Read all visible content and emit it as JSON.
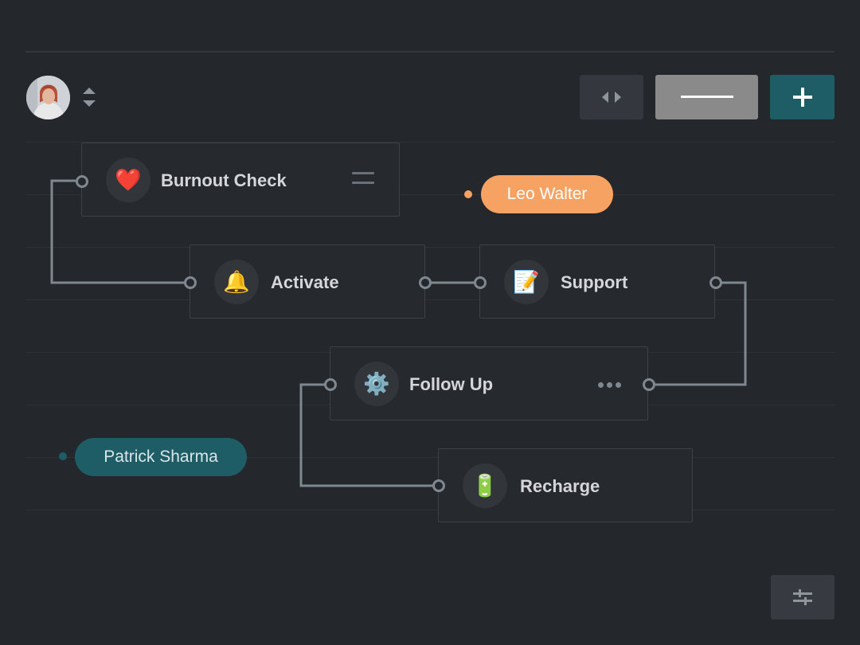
{
  "toolbar": {
    "buttons": [
      {
        "name": "collapse-expand",
        "icon": "code-arrows-icon"
      },
      {
        "name": "minus",
        "icon": "minus-line-icon"
      },
      {
        "name": "add",
        "icon": "plus-icon"
      }
    ]
  },
  "nodes": [
    {
      "id": "burnout-check",
      "label": "Burnout Check",
      "emoji": "❤️",
      "icon": "heart-icon"
    },
    {
      "id": "activate",
      "label": "Activate",
      "emoji": "🔔",
      "icon": "bell-icon"
    },
    {
      "id": "support",
      "label": "Support",
      "emoji": "📝",
      "icon": "memo-icon"
    },
    {
      "id": "follow-up",
      "label": "Follow Up",
      "emoji": "⚙️",
      "icon": "gear-icon"
    },
    {
      "id": "recharge",
      "label": "Recharge",
      "emoji": "🔋",
      "icon": "battery-icon"
    }
  ],
  "assignees": [
    {
      "name": "Leo Walter",
      "color": "#f5a263"
    },
    {
      "name": "Patrick Sharma",
      "color": "#1f5d66"
    }
  ],
  "colors": {
    "background": "#24272c",
    "accent_teal": "#1f5d66",
    "accent_orange": "#f5a263",
    "port": "#7f8791"
  }
}
